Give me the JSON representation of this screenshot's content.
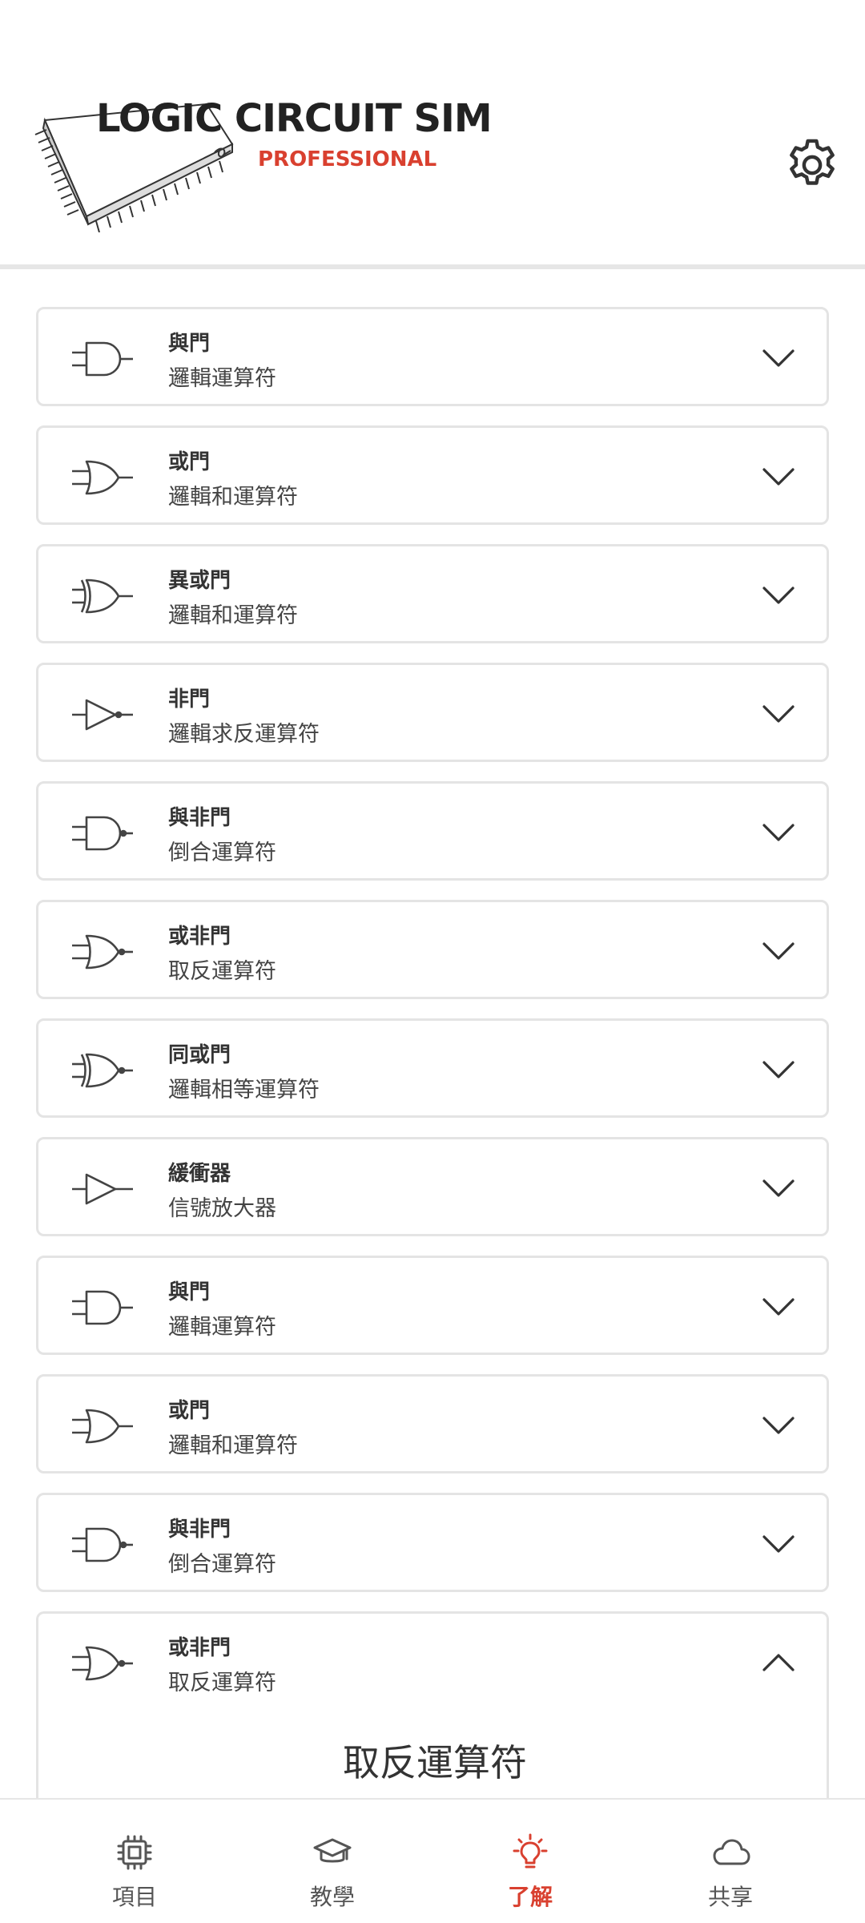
{
  "header": {
    "title": "LOGIC CIRCUIT SIM",
    "subtitle": "PROFESSIONAL",
    "settings_icon": "gear-icon"
  },
  "gates": [
    {
      "title": "與門",
      "subtitle": "邏輯運算符",
      "icon": "and-gate-icon",
      "expanded": false
    },
    {
      "title": "或門",
      "subtitle": "邏輯和運算符",
      "icon": "or-gate-icon",
      "expanded": false
    },
    {
      "title": "異或門",
      "subtitle": "邏輯和運算符",
      "icon": "xor-gate-icon",
      "expanded": false
    },
    {
      "title": "非門",
      "subtitle": "邏輯求反運算符",
      "icon": "not-gate-icon",
      "expanded": false
    },
    {
      "title": "與非門",
      "subtitle": "倒合運算符",
      "icon": "nand-gate-icon",
      "expanded": false
    },
    {
      "title": "或非門",
      "subtitle": "取反運算符",
      "icon": "nor-gate-icon",
      "expanded": false
    },
    {
      "title": "同或門",
      "subtitle": "邏輯相等運算符",
      "icon": "xnor-gate-icon",
      "expanded": false
    },
    {
      "title": "緩衝器",
      "subtitle": "信號放大器",
      "icon": "buffer-gate-icon",
      "expanded": false
    },
    {
      "title": "與門",
      "subtitle": "邏輯運算符",
      "icon": "and-gate-icon",
      "expanded": false
    },
    {
      "title": "或門",
      "subtitle": "邏輯和運算符",
      "icon": "or-gate-icon",
      "expanded": false
    },
    {
      "title": "與非門",
      "subtitle": "倒合運算符",
      "icon": "nand-gate-icon",
      "expanded": false
    },
    {
      "title": "或非門",
      "subtitle": "取反運算符",
      "icon": "nor-gate-icon",
      "expanded": true,
      "detail": "取反運算符"
    }
  ],
  "bottom_nav": [
    {
      "label": "項目",
      "icon": "chip-icon",
      "active": false
    },
    {
      "label": "教學",
      "icon": "graduation-cap-icon",
      "active": false
    },
    {
      "label": "了解",
      "icon": "lightbulb-icon",
      "active": true
    },
    {
      "label": "共享",
      "icon": "cloud-icon",
      "active": false
    }
  ],
  "colors": {
    "accent": "#d9402f",
    "text": "#333333",
    "border": "#e4e4e4"
  }
}
